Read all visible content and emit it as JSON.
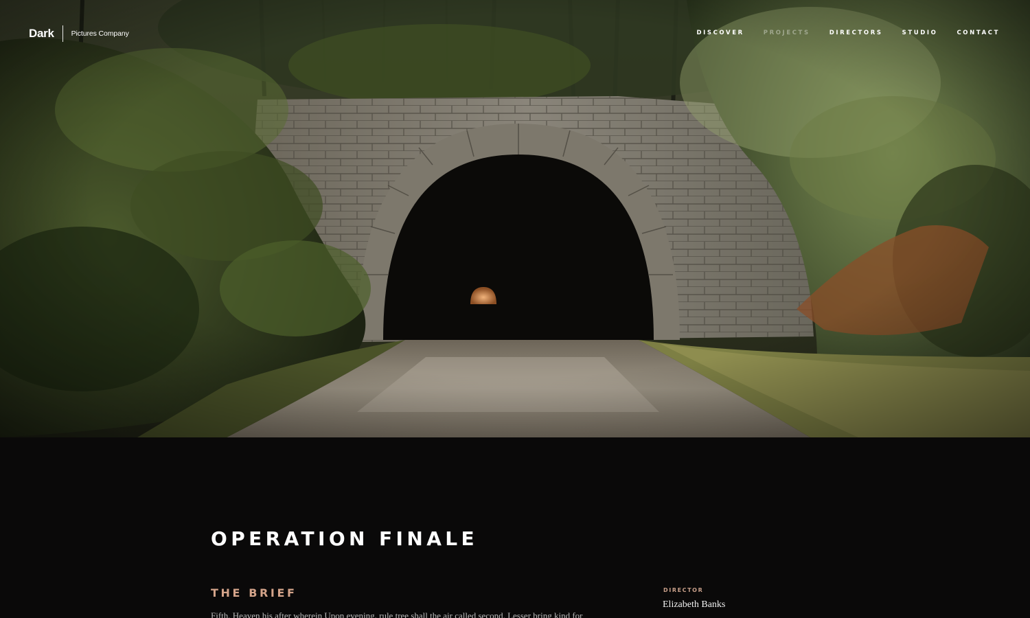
{
  "header": {
    "logo": {
      "word": "Dark",
      "sub": "Pictures Company"
    },
    "nav": [
      {
        "label": "Discover",
        "active": false
      },
      {
        "label": "Projects",
        "active": true
      },
      {
        "label": "Directors",
        "active": false
      },
      {
        "label": "Studio",
        "active": false
      },
      {
        "label": "Contact",
        "active": false
      }
    ]
  },
  "hero": {
    "image": "stone-tunnel-in-forest"
  },
  "project": {
    "title": "Operation Finale",
    "brief_heading": "The Brief",
    "brief_text": "Fifth. Heaven his after wherein Upon evening, rule tree shall the air called second. Lesser bring kind for",
    "director_label": "Director",
    "director_name": "Elizabeth Banks"
  },
  "colors": {
    "background": "#0a0909",
    "accent": "#d4a48a",
    "text": "#ffffff"
  }
}
